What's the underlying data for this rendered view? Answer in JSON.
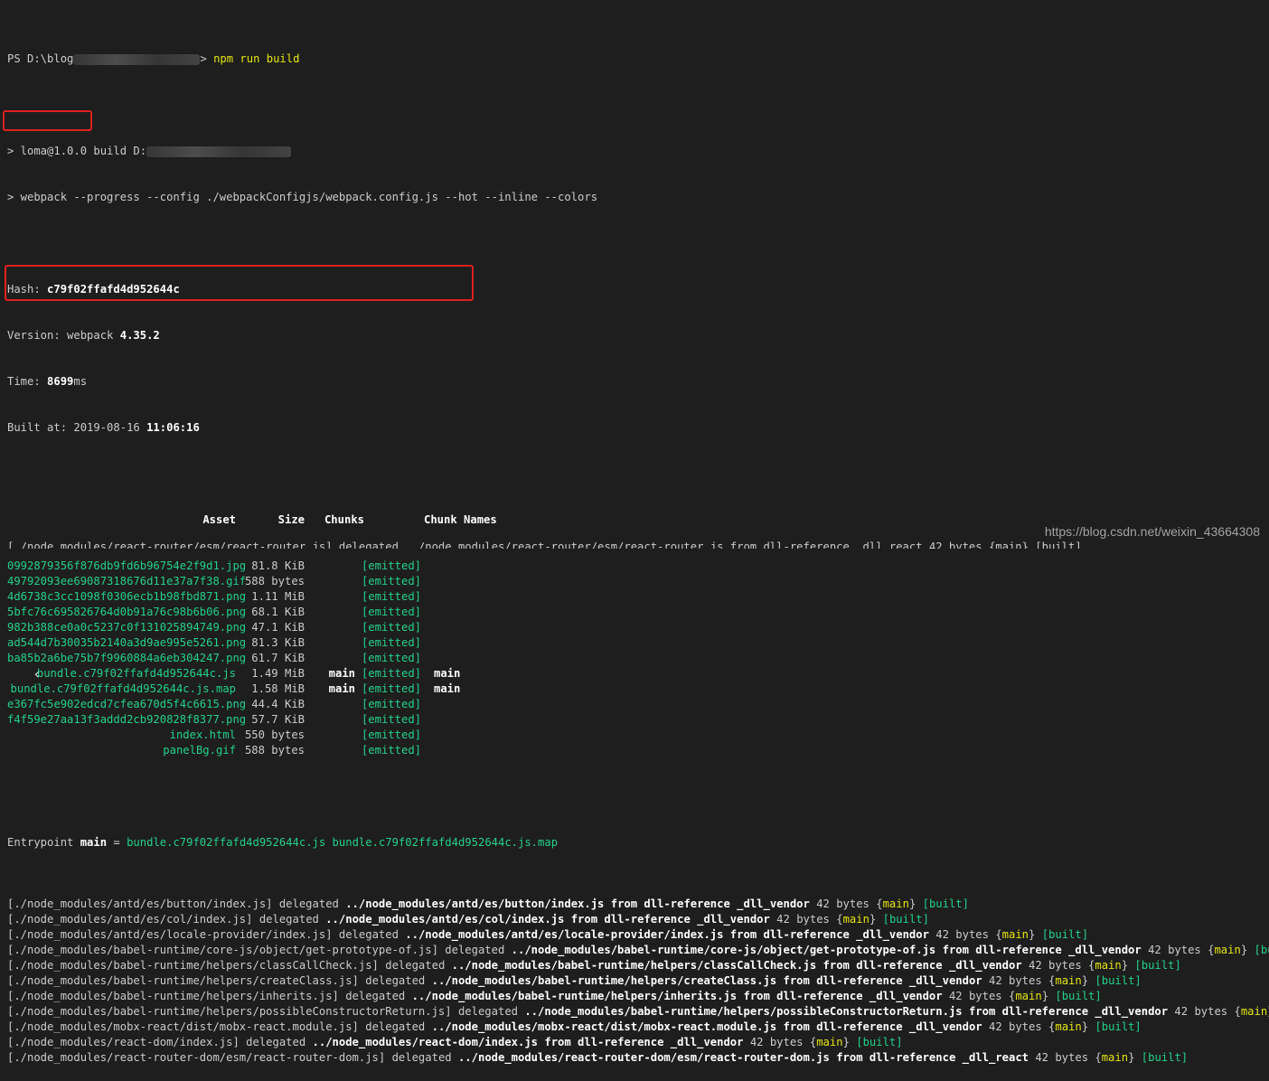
{
  "terminal": {
    "prompt_prefix": "PS D:\\blog",
    "prompt_suffix": "> ",
    "command": "npm run build",
    "script_line_prefix": "> loma@1.0.0 build D:",
    "script_line_cmd": "> webpack --progress --config ./webpackConfigjs/webpack.config.js --hot --inline --colors",
    "hash_label": "Hash: ",
    "hash_value": "c79f02ffafd4d952644c",
    "version_label": "Version: webpack ",
    "version_value": "4.35.2",
    "time_label": "Time: ",
    "time_value": "8699",
    "time_unit": "ms",
    "built_label": "Built at: 2019-08-16 ",
    "built_time": "11:06:16",
    "headers": {
      "asset": "Asset",
      "size": "Size",
      "chunks": "Chunks",
      "chunk_names": "Chunk Names"
    },
    "assets": [
      {
        "name": "0992879356f876db9fd6b96754e2f9d1.jpg",
        "size": "81.8 KiB",
        "chunks": "",
        "status": "[emitted]",
        "names": ""
      },
      {
        "name": "49792093ee69087318676d11e37a7f38.gif",
        "size": "588 bytes",
        "chunks": "",
        "status": "[emitted]",
        "names": ""
      },
      {
        "name": "4d6738c3cc1098f0306ecb1b98fbd871.png",
        "size": "1.11 MiB",
        "chunks": "",
        "status": "[emitted]",
        "names": ""
      },
      {
        "name": "5bfc76c695826764d0b91a76c98b6b06.png",
        "size": "68.1 KiB",
        "chunks": "",
        "status": "[emitted]",
        "names": ""
      },
      {
        "name": "982b388ce0a0c5237c0f131025894749.png",
        "size": "47.1 KiB",
        "chunks": "",
        "status": "[emitted]",
        "names": ""
      },
      {
        "name": "ad544d7b30035b2140a3d9ae995e5261.png",
        "size": "81.3 KiB",
        "chunks": "",
        "status": "[emitted]",
        "names": ""
      },
      {
        "name": "ba85b2a6be75b7f9960884a6eb304247.png",
        "size": "61.7 KiB",
        "chunks": "",
        "status": "[emitted]",
        "names": ""
      },
      {
        "name": "bundle.c79f02ffafd4d952644c.js",
        "size": "1.49 MiB",
        "chunks": "main",
        "status": "[emitted]",
        "names": "main"
      },
      {
        "name": "bundle.c79f02ffafd4d952644c.js.map",
        "size": "1.58 MiB",
        "chunks": "main",
        "status": "[emitted]",
        "names": "main"
      },
      {
        "name": "e367fc5e902edcd7cfea670d5f4c6615.png",
        "size": "44.4 KiB",
        "chunks": "",
        "status": "[emitted]",
        "names": ""
      },
      {
        "name": "f4f59e27aa13f3addd2cb920828f8377.png",
        "size": "57.7 KiB",
        "chunks": "",
        "status": "[emitted]",
        "names": ""
      },
      {
        "name": "index.html",
        "size": "550 bytes",
        "chunks": "",
        "status": "[emitted]",
        "names": ""
      },
      {
        "name": "panelBg.gif",
        "size": "588 bytes",
        "chunks": "",
        "status": "[emitted]",
        "names": ""
      }
    ],
    "entrypoint_label": "Entrypoint ",
    "entrypoint_name": "main",
    "entrypoint_eq": " = ",
    "entrypoint_files": "bundle.c79f02ffafd4d952644c.js bundle.c79f02ffafd4d952644c.js.map",
    "modules": [
      {
        "path": "[./node_modules/antd/es/button/index.js]",
        "target": "../node_modules/antd/es/button/index.js",
        "ref": "_dll_vendor"
      },
      {
        "path": "[./node_modules/antd/es/col/index.js]",
        "target": "../node_modules/antd/es/col/index.js",
        "ref": "_dll_vendor"
      },
      {
        "path": "[./node_modules/antd/es/locale-provider/index.js]",
        "target": "../node_modules/antd/es/locale-provider/index.js",
        "ref": "_dll_vendor"
      },
      {
        "path": "[./node_modules/babel-runtime/core-js/object/get-prototype-of.js]",
        "target": "../node_modules/babel-runtime/core-js/object/get-prototype-of.js",
        "ref": "_dll_vendor"
      },
      {
        "path": "[./node_modules/babel-runtime/helpers/classCallCheck.js]",
        "target": "../node_modules/babel-runtime/helpers/classCallCheck.js",
        "ref": "_dll_vendor"
      },
      {
        "path": "[./node_modules/babel-runtime/helpers/createClass.js]",
        "target": "../node_modules/babel-runtime/helpers/createClass.js",
        "ref": "_dll_vendor"
      },
      {
        "path": "[./node_modules/babel-runtime/helpers/inherits.js]",
        "target": "../node_modules/babel-runtime/helpers/inherits.js",
        "ref": "_dll_vendor"
      },
      {
        "path": "[./node_modules/babel-runtime/helpers/possibleConstructorReturn.js]",
        "target": "../node_modules/babel-runtime/helpers/possibleConstructorReturn.js",
        "ref": "_dll_vendor"
      },
      {
        "path": "[./node_modules/mobx-react/dist/mobx-react.module.js]",
        "target": "../node_modules/mobx-react/dist/mobx-react.module.js",
        "ref": "_dll_vendor"
      },
      {
        "path": "[./node_modules/react-dom/index.js]",
        "target": "../node_modules/react-dom/index.js",
        "ref": "_dll_vendor"
      },
      {
        "path": "[./node_modules/react-router-dom/esm/react-router-dom.js]",
        "target": "../node_modules/react-router-dom/esm/react-router-dom.js",
        "ref": "_dll_react"
      }
    ],
    "module_delegated": " delegated ",
    "module_from": " from dll-reference ",
    "module_size": " 42 bytes ",
    "module_chunk": "main",
    "module_status": "[built]",
    "cut_line": "[./node_modules/react-router/esm/react-router.js] delegated ../node_modules/react-router/esm/react-router.js from dll-reference _dll_react 42 bytes {main} [built]"
  },
  "overlay": {
    "back_icon": "chevron-left-icon",
    "watermark": "https://blog.csdn.net/weixin_43664308"
  },
  "colors": {
    "background": "#1e1e1e",
    "text": "#cccccc",
    "green": "#23d18b",
    "yellow": "#e5e510",
    "highlight": "#e02020"
  }
}
